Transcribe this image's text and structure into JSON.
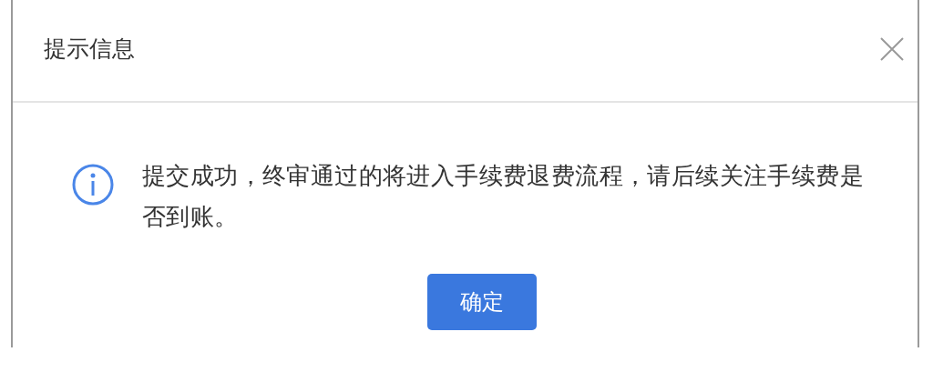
{
  "dialog": {
    "title": "提示信息",
    "message": "提交成功，终审通过的将进入手续费退费流程，请后续关注手续费是否到账。",
    "buttons": [
      "确定"
    ]
  }
}
